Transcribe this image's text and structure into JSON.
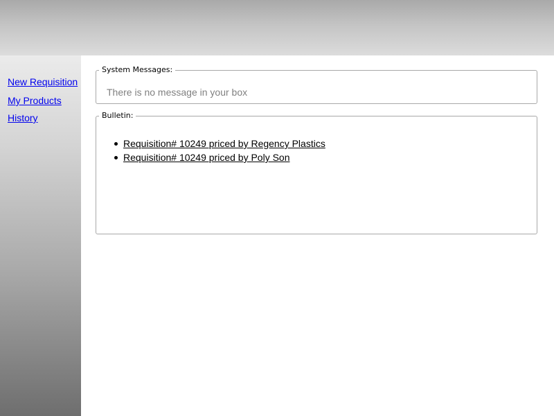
{
  "sidebar": {
    "links": [
      {
        "label": "New Requisition"
      },
      {
        "label": "My Products"
      },
      {
        "label": "History"
      }
    ]
  },
  "system_messages": {
    "legend": "System Messages:",
    "message": "There is no message in your box"
  },
  "bulletin": {
    "legend": "Bulletin:",
    "items": [
      {
        "label": "Requisition# 10249 priced by Regency Plastics"
      },
      {
        "label": "Requisition# 10249 priced by Poly Son"
      }
    ]
  },
  "colors": {
    "link": "#0000ee",
    "muted_text": "#808080",
    "border": "#a8a8a8"
  }
}
